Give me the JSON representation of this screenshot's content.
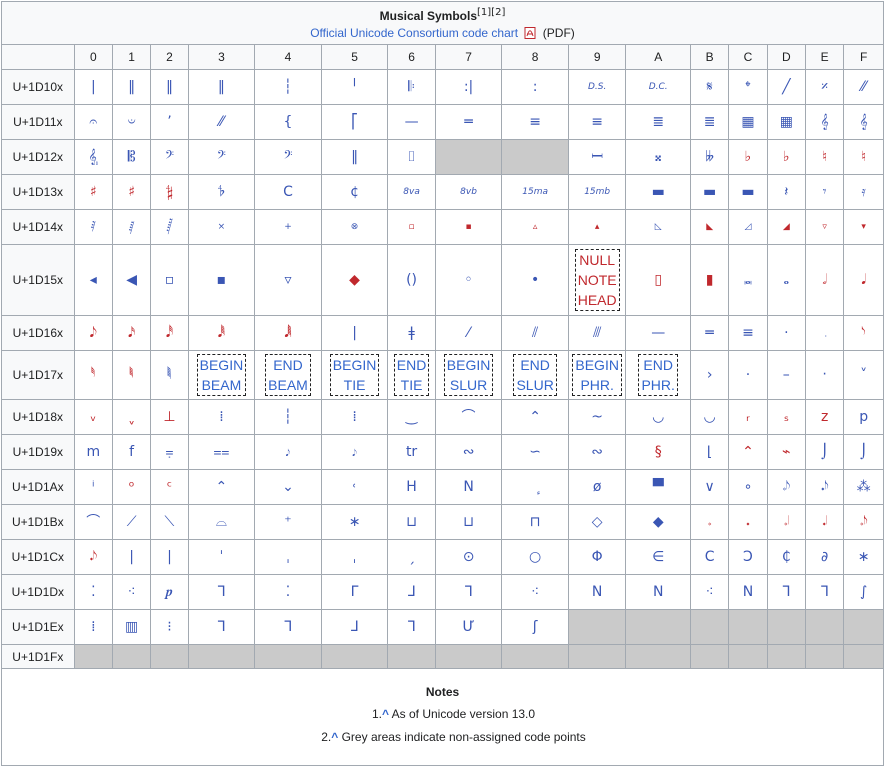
{
  "title": "Musical Symbols",
  "title_refs": "[1][2]",
  "chart_link": "Official Unicode Consortium code chart",
  "chart_suffix": "(PDF)",
  "columns": [
    "0",
    "1",
    "2",
    "3",
    "4",
    "5",
    "6",
    "7",
    "8",
    "9",
    "A",
    "B",
    "C",
    "D",
    "E",
    "F"
  ],
  "rows": [
    {
      "label": "U+1D10x",
      "cells": [
        "|",
        "‖",
        "‖",
        "‖",
        "┆",
        "╵",
        "𝄆",
        ":|",
        ":",
        "D.S.",
        "D.C.",
        "𝄋",
        "𝄌",
        "╱",
        "𝄎",
        "⁄⁄"
      ]
    },
    {
      "label": "U+1D11x",
      "cells": [
        "𝄐",
        "𝄑",
        "’",
        "⁄⁄",
        "{",
        "⎡",
        "—",
        "═",
        "≡",
        "≡",
        "≣",
        "≣",
        "▦",
        "▦",
        "𝄞",
        "𝄞"
      ]
    },
    {
      "label": "U+1D12x",
      "cells": [
        "𝄠",
        "𝄡",
        "𝄢",
        "𝄢",
        "𝄢",
        "‖",
        "⌷",
        "",
        "",
        "𝄩",
        "𝄪",
        "𝄫",
        "♭",
        "♭",
        "♮",
        "♮"
      ]
    },
    {
      "label": "U+1D13x",
      "cells": [
        "♯",
        "♯",
        "𝄲",
        "𝄳",
        "C",
        "¢",
        "8va",
        "8vb",
        "15ma",
        "15mb",
        "▬",
        "▬",
        "▬",
        "𝄽",
        "𝄾",
        "𝄿"
      ]
    },
    {
      "label": "U+1D14x",
      "cells": [
        "𝅀",
        "𝅁",
        "𝅂",
        "×",
        "+",
        "⊗",
        "▫",
        "▪",
        "▵",
        "▴",
        "◺",
        "◣",
        "◿",
        "◢",
        "▿",
        "▾"
      ]
    },
    {
      "label": "U+1D15x",
      "cells": [
        "◂",
        "◀",
        "▫",
        "▪",
        "▿",
        "◆",
        "()",
        "◦",
        "•",
        "NULL NOTE HEAD",
        "▯",
        "▮",
        "𝅜",
        "𝅝",
        "𝅗𝅥",
        "𝅘𝅥"
      ]
    },
    {
      "label": "U+1D16x",
      "cells": [
        "𝅘𝅥𝅮",
        "𝅘𝅥𝅯",
        "𝅘𝅥𝅰",
        "𝅘𝅥𝅱",
        "𝅘𝅥𝅲",
        "|",
        "ǂ",
        "⁄",
        "⫽",
        "⫻",
        "—",
        "═",
        "≡",
        "·",
        "𝅭",
        "𝅮"
      ]
    },
    {
      "label": "U+1D17x",
      "cells": [
        "𝅰",
        "𝅱",
        "𝅲",
        "BEGIN BEAM",
        "END BEAM",
        "BEGIN TIE",
        "END TIE",
        "BEGIN SLUR",
        "END SLUR",
        "BEGIN PHR.",
        "END PHR.",
        "›",
        "·",
        "–",
        "‧",
        "˅"
      ]
    },
    {
      "label": "U+1D18x",
      "cells": [
        "ᵥ",
        "ˬ",
        "⊥",
        "⁞",
        "┆",
        "⁞",
        "‿",
        "⌒",
        "⌃",
        "~",
        "◡",
        "◡",
        "ᵣ",
        "ₛ",
        "z",
        "p"
      ]
    },
    {
      "label": "U+1D19x",
      "cells": [
        "m",
        "f",
        "⩦",
        "⩵",
        "𝆕",
        "𝆕",
        "tr",
        "∾",
        "∽",
        "∾",
        "§",
        "⌊",
        "⌃",
        "⌁",
        "⌡",
        "⌡"
      ]
    },
    {
      "label": "U+1D1Ax",
      "cells": [
        "ⁱ",
        "ᵒ",
        "ᶜ",
        "⌃",
        "⌄",
        "˓",
        "H",
        "N",
        "ٕ",
        "ø",
        "▀",
        "∨",
        "∘",
        "𝆹𝅥𝅮",
        "𝆺𝅥𝅮",
        "⁂"
      ]
    },
    {
      "label": "U+1D1Bx",
      "cells": [
        "⌒",
        "⟋",
        "⟍",
        "⌓",
        "⁺",
        "∗",
        "⊔",
        "⊔",
        "⊓",
        "◇",
        "◆",
        "𝆹",
        "𝆺",
        "𝆹𝅥",
        "𝆺𝅥",
        "𝆹𝅥𝅮"
      ]
    },
    {
      "label": "U+1D1Cx",
      "cells": [
        "𝆺𝅥𝅮",
        "|",
        "|",
        "ˈ",
        "ˌ",
        "ˌ",
        "ˏ",
        "⊙",
        "○",
        "Φ",
        "∈",
        "C",
        "Ͻ",
        "₵",
        "∂",
        "∗"
      ]
    },
    {
      "label": "U+1D1Dx",
      "cells": [
        "⁚",
        "⁖",
        "𝆏",
        "ᒣ",
        "⁚",
        "ᒥ",
        "ᒧ",
        "ᒣ",
        "⁖",
        "Ν",
        "Ν",
        "⁖",
        "Ν",
        "ᒣ",
        "ᒣ",
        "∫"
      ]
    },
    {
      "label": "U+1D1Ex",
      "cells": [
        "⁞",
        "▥",
        "⁝",
        "ᒣ",
        "ᒣ",
        "ᒧ",
        "ᒣ",
        "Ư",
        "ʃ",
        "",
        "",
        "",
        "",
        "",
        "",
        ""
      ]
    },
    {
      "label": "U+1D1Fx",
      "cells": [
        "",
        "",
        "",
        "",
        "",
        "",
        "",
        "",
        "",
        "",
        "",
        "",
        "",
        "",
        "",
        ""
      ]
    }
  ],
  "notes_title": "Notes",
  "notes": [
    {
      "num": "1.",
      "caret": "^",
      "text": "As of Unicode version 13.0"
    },
    {
      "num": "2.",
      "caret": "^",
      "text": "Grey areas indicate non-assigned code points"
    }
  ]
}
